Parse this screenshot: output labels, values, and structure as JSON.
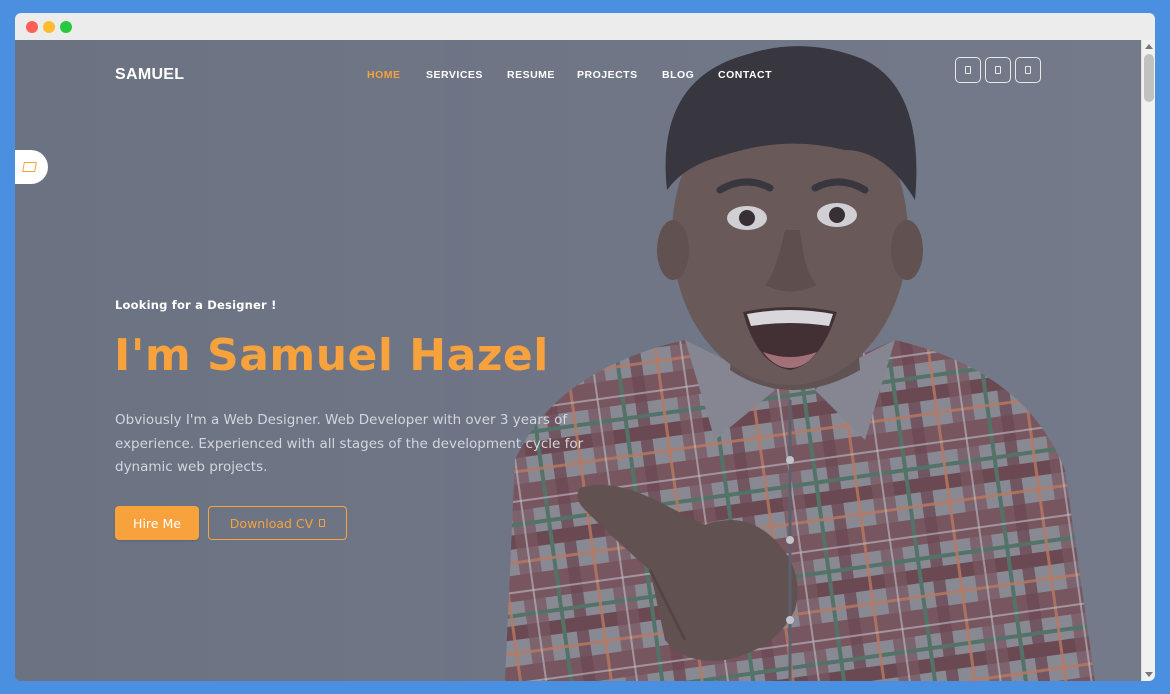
{
  "brand": {
    "logo": "SAMUEL"
  },
  "nav": {
    "items": [
      {
        "label": "HOME",
        "active": true
      },
      {
        "label": "SERVICES",
        "active": false
      },
      {
        "label": "RESUME",
        "active": false
      },
      {
        "label": "PROJECTS",
        "active": false
      },
      {
        "label": "BLOG",
        "active": false
      },
      {
        "label": "CONTACT",
        "active": false
      }
    ]
  },
  "social": {
    "icons": [
      "social-icon",
      "social-icon",
      "social-icon"
    ]
  },
  "hero": {
    "subtitle": "Looking for a Designer !",
    "headline": "I'm Samuel Hazel",
    "description": "Obviously I'm a Web Designer. Web Developer with over 3 years of experience. Experienced with all stages of the development cycle for dynamic web projects.",
    "hire_label": "Hire Me",
    "cv_label": "Download CV"
  },
  "colors": {
    "accent": "#f7a23c",
    "overlay": "#6e7585",
    "text": "#ffffff"
  }
}
